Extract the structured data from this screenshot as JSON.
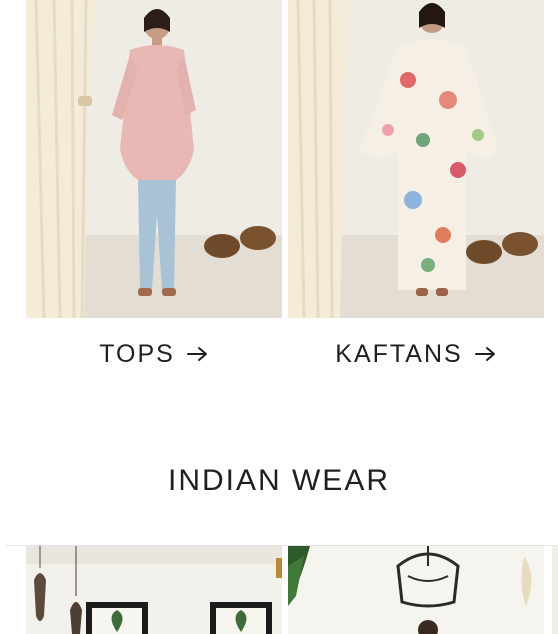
{
  "categories_row": [
    {
      "label": "TOPS",
      "image": "model-in-pink-sheer-shirt-and-light-jeans"
    },
    {
      "label": "KAFTANS",
      "image": "model-in-white-floral-kaftan"
    }
  ],
  "section": {
    "title": "INDIAN WEAR"
  },
  "indian_wear_images": [
    {
      "image": "room-with-pendant-lamps-and-framed-leaf-prints"
    },
    {
      "image": "model-under-black-iron-chandelier"
    }
  ],
  "icons": {
    "arrow": "arrow-right-icon"
  },
  "colors": {
    "text": "#1f1f1f",
    "divider": "#e2e2e2",
    "background": "#ffffff"
  }
}
